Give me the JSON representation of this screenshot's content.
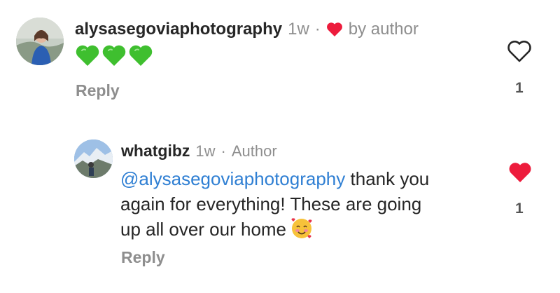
{
  "comments": [
    {
      "username": "alysasegoviaphotography",
      "time": "1w",
      "liked_by_label": "by author",
      "emojis": [
        "green-heart",
        "green-heart",
        "green-heart"
      ],
      "reply_label": "Reply",
      "like_count": "1",
      "liked": false
    }
  ],
  "reply": {
    "username": "whatgibz",
    "time": "1w",
    "badge": "Author",
    "mention": "@alysasegoviaphotography",
    "text_line1": " thank you",
    "text_line2": "again for everything! These are going",
    "text_line3": "up all over our home",
    "emoji": "smiling-face-with-hearts",
    "reply_label": "Reply",
    "like_count": "1",
    "liked": true
  },
  "colors": {
    "like_red": "#ed1c3c",
    "mention_blue": "#2f7fd3",
    "meta_gray": "#8e8e8e",
    "green_heart": "#3fbf2f"
  }
}
